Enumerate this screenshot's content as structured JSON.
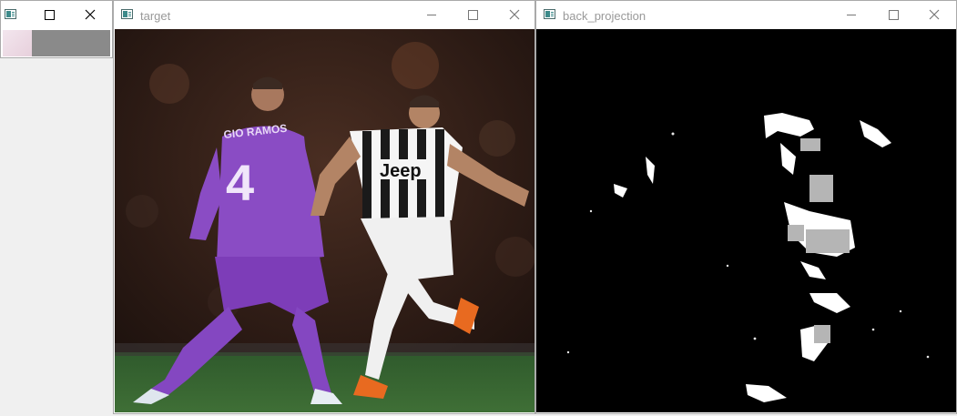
{
  "windows": {
    "small": {
      "title": "",
      "controls": [
        "minimize",
        "maximize",
        "close"
      ]
    },
    "target": {
      "title": "target",
      "controls": [
        "minimize",
        "maximize",
        "close"
      ]
    },
    "back_projection": {
      "title": "back_projection",
      "controls": [
        "minimize",
        "maximize",
        "close"
      ]
    }
  },
  "colors": {
    "window_bg": "#ffffff",
    "title_text": "#999999",
    "desktop": "#f0f0f0",
    "roi_gray": "#8a8a8a",
    "roi_pink": "#efdde6"
  },
  "images": {
    "target": {
      "content": "football-photo",
      "shirt_text_1": "4",
      "shirt_text_2": "Jeep"
    },
    "back_projection": {
      "content": "binary-mask"
    }
  }
}
